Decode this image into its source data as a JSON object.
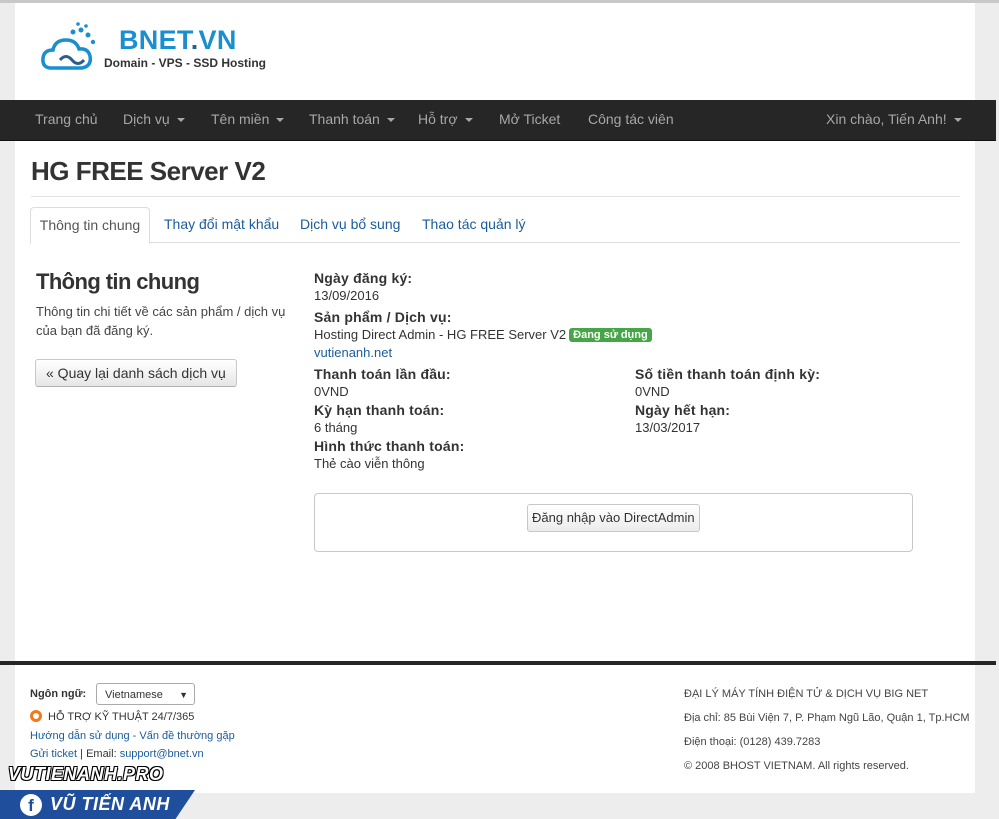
{
  "header": {
    "brand_main": "BNET",
    "brand_dot": ".",
    "brand_tld": "VN",
    "tagline": "Domain - VPS - SSD Hosting"
  },
  "nav": {
    "items": [
      {
        "label": "Trang chủ",
        "dropdown": false
      },
      {
        "label": "Dịch vụ",
        "dropdown": true
      },
      {
        "label": "Tên miền",
        "dropdown": true
      },
      {
        "label": "Thanh toán",
        "dropdown": true
      },
      {
        "label": "Hỗ trợ",
        "dropdown": true
      },
      {
        "label": "Mở Ticket",
        "dropdown": false
      },
      {
        "label": "Công tác viên",
        "dropdown": false
      }
    ],
    "user_greeting": "Xin chào, Tiến Anh!"
  },
  "page": {
    "title": "HG FREE Server V2",
    "tabs": [
      "Thông tin chung",
      "Thay đổi mật khẩu",
      "Dịch vụ bổ sung",
      "Thao tác quản lý"
    ],
    "active_tab": "Thông tin chung"
  },
  "sidebar": {
    "heading": "Thông tin chung",
    "description": "Thông tin chi tiết về các sản phẩm / dịch vụ của bạn đã đăng ký.",
    "back_button": "« Quay lại danh sách dịch vụ"
  },
  "details": {
    "reg_date_label": "Ngày đăng ký:",
    "reg_date": "13/09/2016",
    "product_label": "Sản phẩm / Dịch vụ:",
    "product": "Hosting Direct Admin - HG FREE Server V2",
    "status": "Đang sử dụng",
    "domain": "vutienanh.net",
    "first_payment_label": "Thanh toán lần đầu:",
    "first_payment": "0VND",
    "recurring_label": "Số tiền thanh toán định kỳ:",
    "recurring": "0VND",
    "cycle_label": "Kỳ hạn thanh toán:",
    "cycle": "6 tháng",
    "due_label": "Ngày hết hạn:",
    "due": "13/03/2017",
    "method_label": "Hình thức thanh toán:",
    "method": "Thẻ cào viễn thông",
    "login_button": "Đăng nhập vào DirectAdmin"
  },
  "footer": {
    "lang_label": "Ngôn ngữ:",
    "lang_value": "Vietnamese",
    "support": "HỖ TRỢ KỸ THUẬT 24/7/365",
    "guide_link": "Hướng dẫn sử dụng - Vấn đề thường gặp",
    "ticket_link": "Gửi ticket",
    "email_prefix": " | Email: ",
    "email": "support@bnet.vn",
    "company": "ĐẠI LÝ MÁY TÍNH ĐIỆN TỬ & DỊCH VỤ BIG NET",
    "address": "Địa chỉ: 85 Bùi Viện 7, P. Phạm Ngũ Lão, Quận 1, Tp.HCM",
    "phone": "Điện thoại: (0128) 439.7283",
    "copyright": "© 2008 BHOST VIETNAM. All rights reserved."
  },
  "watermark": {
    "site": "VUTIENANH.PRO",
    "fb_letter": "f",
    "name": "VŨ TIẾN ANH"
  },
  "colors": {
    "brand_blue": "#1a8fd0",
    "navbar": "#262626",
    "link": "#1a5c9a",
    "status_green": "#46a546",
    "support_orange": "#f07a1a"
  }
}
